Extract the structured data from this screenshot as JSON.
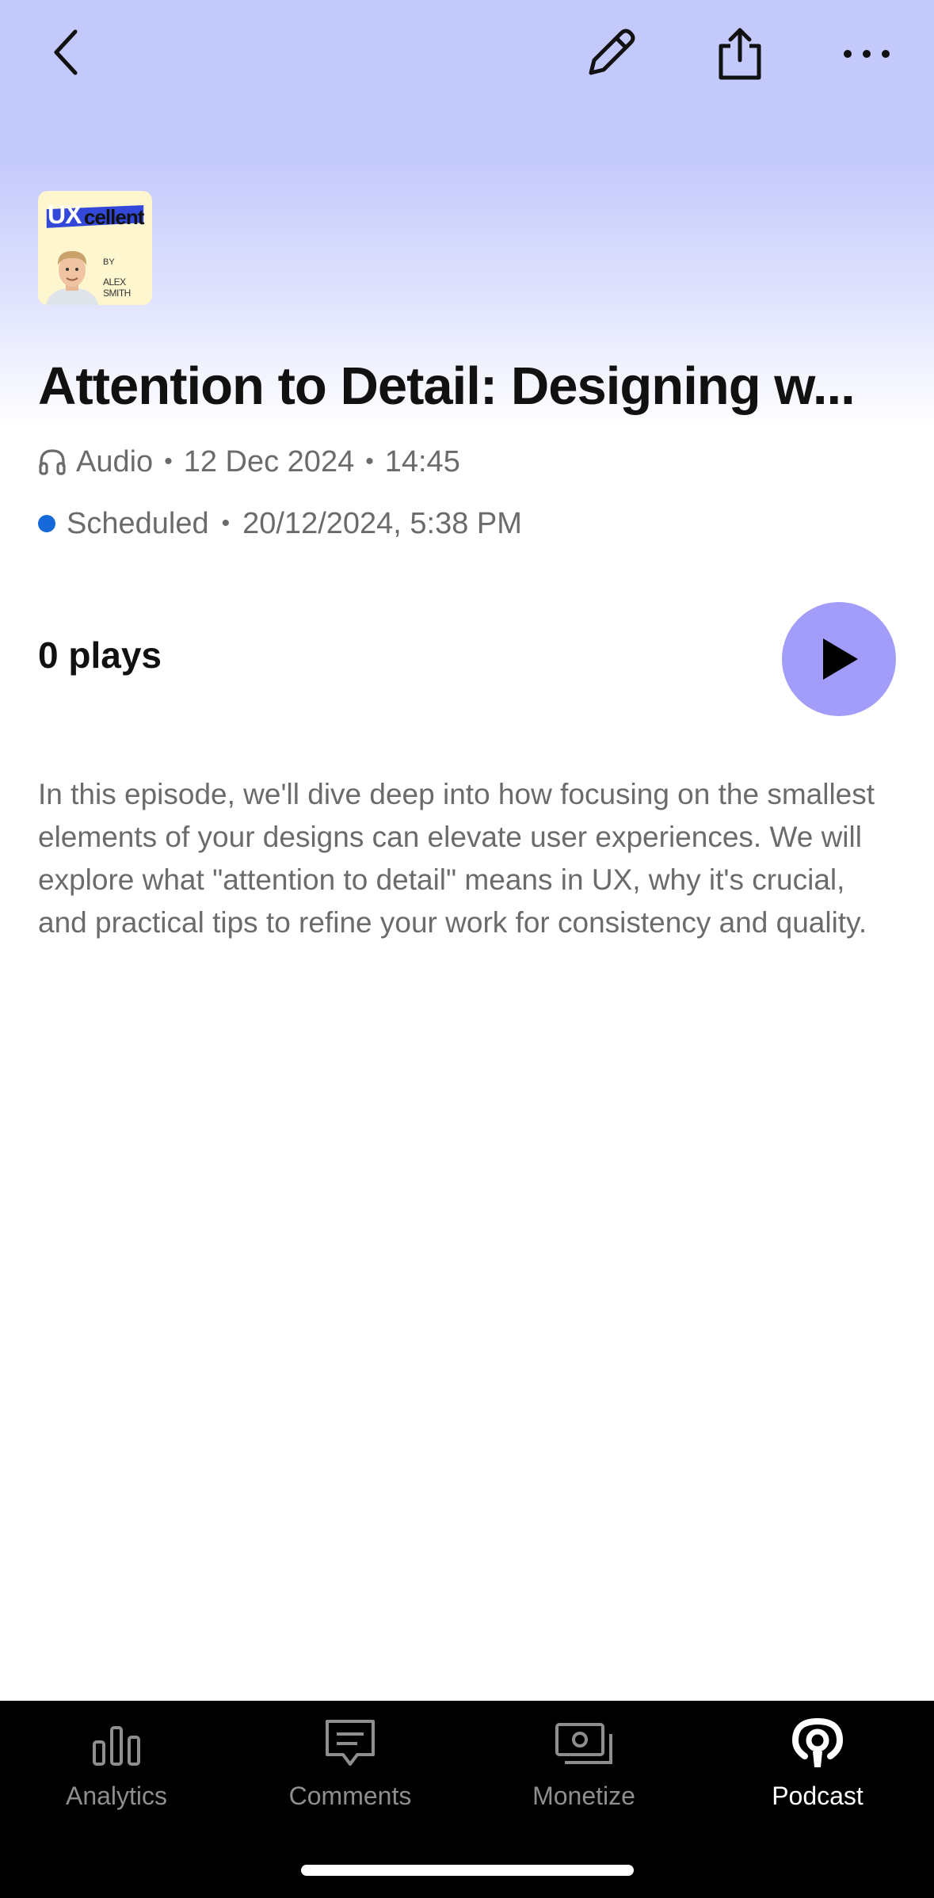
{
  "header": {
    "back_icon": "chevron-left-icon",
    "edit_icon": "pencil-icon",
    "share_icon": "share-icon",
    "more_icon": "more-horizontal-icon"
  },
  "cover": {
    "ux_text": "UX",
    "cellent_text": "cellent",
    "by_text": "BY",
    "author_text": "ALEX SMITH",
    "band_color": "#3348d8"
  },
  "episode": {
    "title": "Attention to Detail: Designing w...",
    "type_label": "Audio",
    "date": "12 Dec 2024",
    "duration": "14:45",
    "status_label": "Scheduled",
    "scheduled_datetime": "20/12/2024, 5:38 PM",
    "status_color": "#1569d8",
    "plays": "0 plays",
    "description": "In this episode, we'll dive deep into how focusing on the smallest elements of your designs can elevate user experiences. We will explore what \"attention to detail\" means in UX, why it's crucial, and practical tips to refine your work for consistency and quality."
  },
  "play_button": {
    "icon": "play-icon",
    "color": "#a29df8"
  },
  "tabbar": {
    "tabs": [
      {
        "label": "Analytics",
        "icon": "bar-chart-icon",
        "active": false
      },
      {
        "label": "Comments",
        "icon": "comment-icon",
        "active": false
      },
      {
        "label": "Monetize",
        "icon": "money-icon",
        "active": false
      },
      {
        "label": "Podcast",
        "icon": "podcast-icon",
        "active": true
      }
    ]
  }
}
